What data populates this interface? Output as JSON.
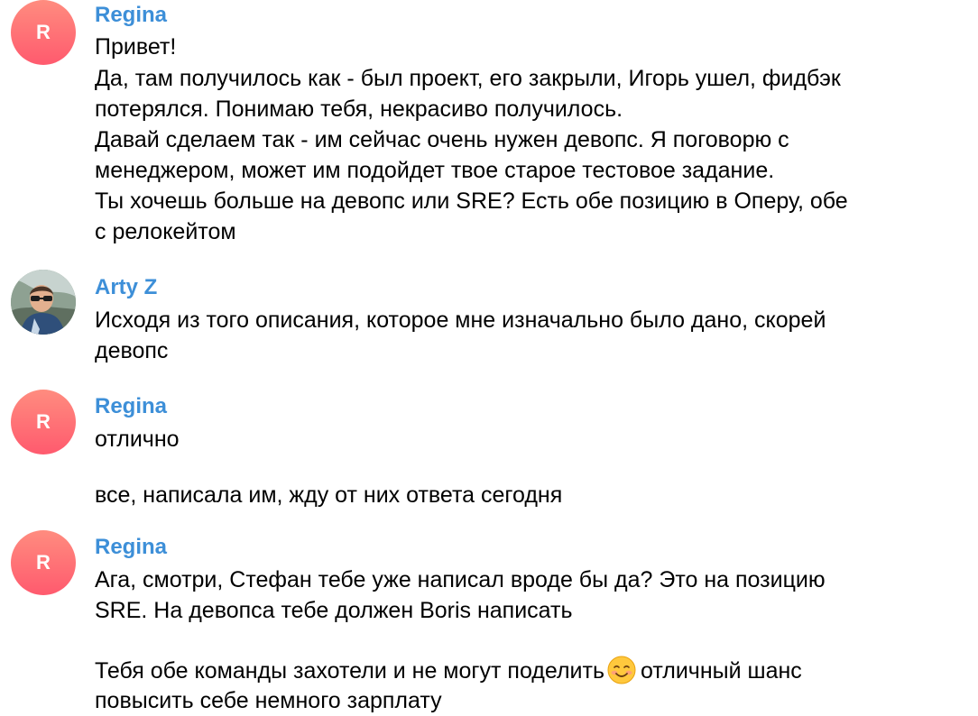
{
  "messages": [
    {
      "sender": "Regina",
      "avatar_letter": "R",
      "lines": [
        "Привет!",
        "Да, там получилось как - был проект, его закрыли, Игорь ушел, фидбэк",
        "потерялся. Понимаю тебя, некрасиво получилось.",
        "Давай сделаем так - им сейчас очень нужен девопс. Я поговорю с",
        "менеджером, может им подойдет твое старое тестовое задание.",
        "Ты хочешь больше на девопс или SRE? Есть обе позицию в Оперу, обе",
        "с релокейтом"
      ]
    },
    {
      "sender": "Arty Z",
      "lines": [
        "Исходя из того описания, которое мне изначально было дано, скорей",
        "девопс"
      ]
    },
    {
      "sender": "Regina",
      "avatar_letter": "R",
      "lines": [
        "отлично",
        "все, написала им, жду от них ответа сегодня"
      ]
    },
    {
      "sender": "Regina",
      "avatar_letter": "R",
      "lines": [
        "Ага, смотри, Стефан тебе уже написал вроде бы да? Это на позицию",
        "SRE. На девопса тебе должен Boris написать",
        "Тебя обе команды захотели и не могут поделить",
        "отличный шанс",
        "повысить себе немного зарплату"
      ],
      "emoji": "smiling-face-icon"
    }
  ],
  "colors": {
    "sender_name": "#3d8fd8",
    "avatar_gradient_top": "#ff8c7f",
    "avatar_gradient_bottom": "#ff5a6e",
    "text": "#000000",
    "background": "#ffffff"
  }
}
